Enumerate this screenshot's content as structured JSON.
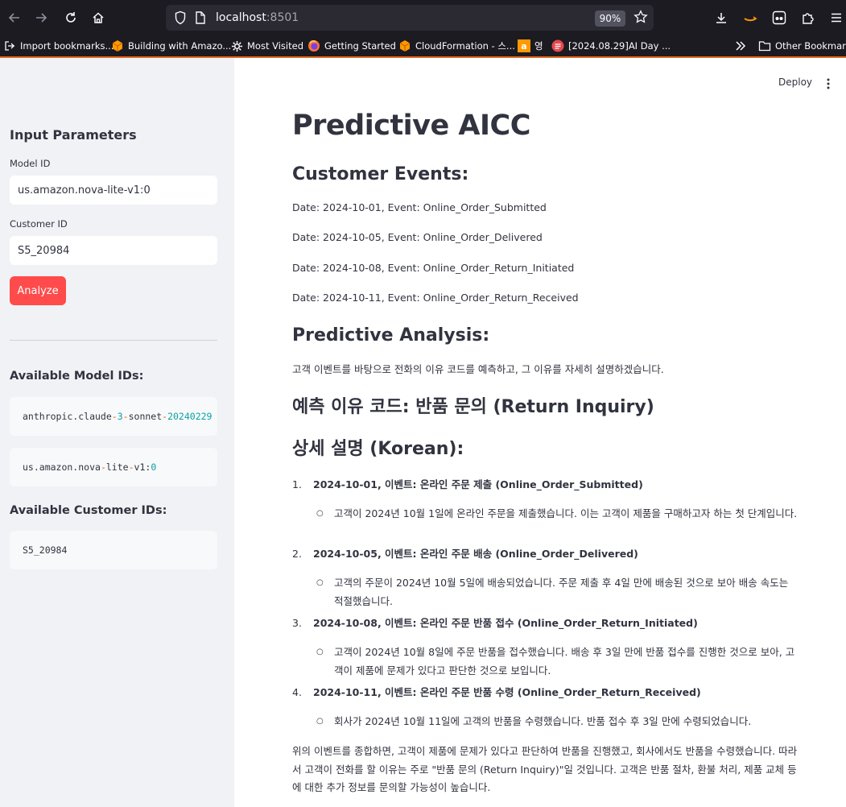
{
  "browser": {
    "url_host": "localhost",
    "url_port": ":8501",
    "zoom": "90%",
    "bookmarks": [
      "Import bookmarks...",
      "Building with Amazo...",
      "Most Visited",
      "Getting Started",
      "CloudFormation - 스...",
      "영",
      "[2024.08.29]AI Day ...",
      "Other Bookmarks"
    ]
  },
  "sidebar": {
    "heading": "Input Parameters",
    "model_label": "Model ID",
    "model_value": "us.amazon.nova-lite-v1:0",
    "customer_label": "Customer ID",
    "customer_value": "S5_20984",
    "analyze_label": "Analyze",
    "models_heading": "Available Model IDs:",
    "model_ids": {
      "m1_a": "anthropic.claude",
      "m1_b": "-",
      "m1_c": "3",
      "m1_d": "-",
      "m1_e": "sonnet",
      "m1_f": "-",
      "m1_g": "20240229",
      "m2_a": "us.amazon.nova",
      "m2_b": "-",
      "m2_c": "lite",
      "m2_d": "-",
      "m2_e": "v1",
      "m2_f": ":",
      "m2_g": "0"
    },
    "customers_heading": "Available Customer IDs:",
    "customer_id": "S5_20984"
  },
  "main": {
    "deploy_label": "Deploy",
    "title": "Predictive AICC",
    "events_heading": "Customer Events:",
    "events": [
      "Date: 2024-10-01, Event: Online_Order_Submitted",
      "Date: 2024-10-05, Event: Online_Order_Delivered",
      "Date: 2024-10-08, Event: Online_Order_Return_Initiated",
      "Date: 2024-10-11, Event: Online_Order_Return_Received"
    ],
    "analysis_heading": "Predictive Analysis:",
    "analysis_intro": "고객 이벤트를 바탕으로 전화의 이유 코드를 예측하고, 그 이유를 자세히 설명하겠습니다.",
    "reason_heading": "예측 이유 코드: 반품 문의 (Return Inquiry)",
    "detail_heading": "상세 설명 (Korean):",
    "items": [
      {
        "num": "1.",
        "title": "2024-10-01, 이벤트: 온라인 주문 제출 (Online_Order_Submitted)",
        "text": "고객이 2024년 10월 1일에 온라인 주문을 제출했습니다. 이는 고객이 제품을 구매하고자 하는 첫 단계입니다."
      },
      {
        "num": "2.",
        "title": "2024-10-05, 이벤트: 온라인 주문 배송 (Online_Order_Delivered)",
        "text": "고객의 주문이 2024년 10월 5일에 배송되었습니다. 주문 제출 후 4일 만에 배송된 것으로 보아 배송 속도는 적절했습니다."
      },
      {
        "num": "3.",
        "title": "2024-10-08, 이벤트: 온라인 주문 반품 접수 (Online_Order_Return_Initiated)",
        "text": "고객이 2024년 10월 8일에 주문 반품을 접수했습니다. 배송 후 3일 만에 반품 접수를 진행한 것으로 보아, 고객이 제품에 문제가 있다고 판단한 것으로 보입니다."
      },
      {
        "num": "4.",
        "title": "2024-10-11, 이벤트: 온라인 주문 반품 수령 (Online_Order_Return_Received)",
        "text": "회사가 2024년 10월 11일에 고객의 반품을 수령했습니다. 반품 접수 후 3일 만에 수령되었습니다."
      }
    ],
    "summary": "위의 이벤트를 종합하면, 고객이 제품에 문제가 있다고 판단하여 반품을 진행했고, 회사에서도 반품을 수령했습니다. 따라서 고객이 전화를 할 이유는 주로 \"반품 문의 (Return Inquiry)\"일 것입니다. 고객은 반품 절차, 환불 처리, 제품 교체 등에 대한 추가 정보를 문의할 가능성이 높습니다."
  }
}
